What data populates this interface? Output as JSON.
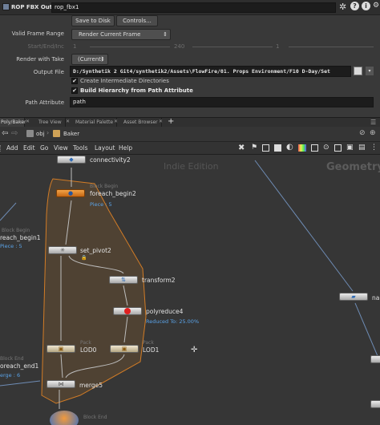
{
  "title_bar": {
    "node_type": "ROP FBX Output",
    "node_name": "rop_fbx1"
  },
  "buttons": {
    "save_to_disk": "Save to Disk",
    "controls": "Controls..."
  },
  "params": {
    "valid_frame_range": {
      "label": "Valid Frame Range",
      "value": "Render Current Frame"
    },
    "start_end_inc": {
      "label": "Start/End/Inc",
      "start": "1",
      "end": "240",
      "inc": "1"
    },
    "render_with_take": {
      "label": "Render with Take",
      "value": "(Current)"
    },
    "output_file": {
      "label": "Output File",
      "value": "D:/Synthetik 2 Git4/synthetik2/Assets\\FlowFire/01. Props Environment/F10 D-Day/Set"
    },
    "create_dirs": {
      "label": "Create Intermediate Directories"
    },
    "build_hierarchy": {
      "label": "Build Hierarchy from Path Attribute"
    },
    "path_attribute": {
      "label": "Path Attribute",
      "value": "path"
    }
  },
  "tabs": [
    "Poly/Baker",
    "Tree View",
    "Material Palette",
    "Asset Browser"
  ],
  "path": {
    "root": "obj",
    "current": "Baker"
  },
  "menu": [
    "Add",
    "Edit",
    "Go",
    "View",
    "Tools",
    "Layout",
    "Help"
  ],
  "watermark": "Indie Edition",
  "context_label": "Geometry",
  "nodes": {
    "connectivity": {
      "label": "connectivity2"
    },
    "foreach_begin2": {
      "ghost": "Block Begin",
      "label": "foreach_begin2",
      "sub": "Piece : 5"
    },
    "foreach_begin1": {
      "ghost": "Block Begin",
      "label": "reach_begin1",
      "sub": "Piece : 5"
    },
    "set_pivot": {
      "label": "set_pivot2"
    },
    "transform": {
      "label": "transform2"
    },
    "polyreduce": {
      "label": "polyreduce4",
      "sub": "Reduced To: 25.00%"
    },
    "lod0": {
      "ghost": "Pack",
      "label": "LOD0"
    },
    "lod1": {
      "ghost": "Pack",
      "label": "LOD1"
    },
    "foreach_end1": {
      "ghost": "Block End",
      "label": "oreach_end1",
      "sub": "erge : 6"
    },
    "merge": {
      "label": "merge5"
    },
    "block_end": {
      "ghost": "Block End"
    },
    "right_node": {
      "label": "na"
    }
  }
}
